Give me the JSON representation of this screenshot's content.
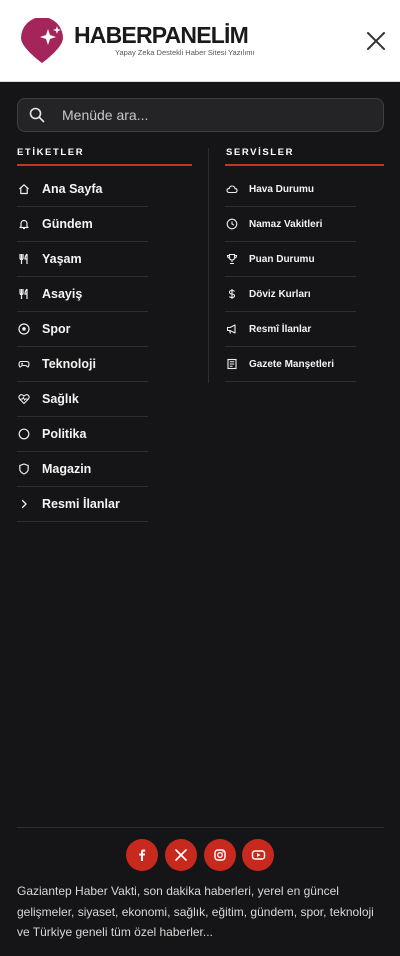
{
  "header": {
    "brand": "HABERPANELİM",
    "tagline": "Yapay Zeka Destekli Haber Sitesi Yazılımı"
  },
  "search": {
    "placeholder": "Menüde ara..."
  },
  "tags_section": {
    "title": "ETİKETLER",
    "items": [
      {
        "label": "Ana Sayfa",
        "icon": "home-icon"
      },
      {
        "label": "Gündem",
        "icon": "bell-icon"
      },
      {
        "label": "Yaşam",
        "icon": "utensils-icon"
      },
      {
        "label": "Asayiş",
        "icon": "utensils-icon"
      },
      {
        "label": "Spor",
        "icon": "soccer-ball-icon"
      },
      {
        "label": "Teknoloji",
        "icon": "gamepad-icon"
      },
      {
        "label": "Sağlık",
        "icon": "heart-pulse-icon"
      },
      {
        "label": "Politika",
        "icon": "circle-icon"
      },
      {
        "label": "Magazin",
        "icon": "shield-icon"
      },
      {
        "label": "Resmi İlanlar",
        "icon": "chevron-right-icon"
      }
    ]
  },
  "services_section": {
    "title": "SERVİSLER",
    "items": [
      {
        "label": "Hava Durumu",
        "icon": "cloud-icon"
      },
      {
        "label": "Namaz Vakitleri",
        "icon": "clock-icon"
      },
      {
        "label": "Puan Durumu",
        "icon": "trophy-icon"
      },
      {
        "label": "Döviz Kurları",
        "icon": "dollar-icon"
      },
      {
        "label": "Resmî İlanlar",
        "icon": "megaphone-icon"
      },
      {
        "label": "Gazete Manşetleri",
        "icon": "newspaper-icon"
      }
    ]
  },
  "social": [
    "facebook-icon",
    "x-icon",
    "instagram-icon",
    "youtube-icon"
  ],
  "footer": {
    "description": "Gaziantep Haber Vakti, son dakika haberleri, yerel en güncel gelişmeler, siyaset, ekonomi, sağlık, eğitim, gündem, spor, teknoloji ve Türkiye geneli tüm özel haberler..."
  },
  "colors": {
    "accent": "#c8291f",
    "logo": "#a3255a",
    "background": "#151517",
    "header_bg": "#ffffff"
  }
}
